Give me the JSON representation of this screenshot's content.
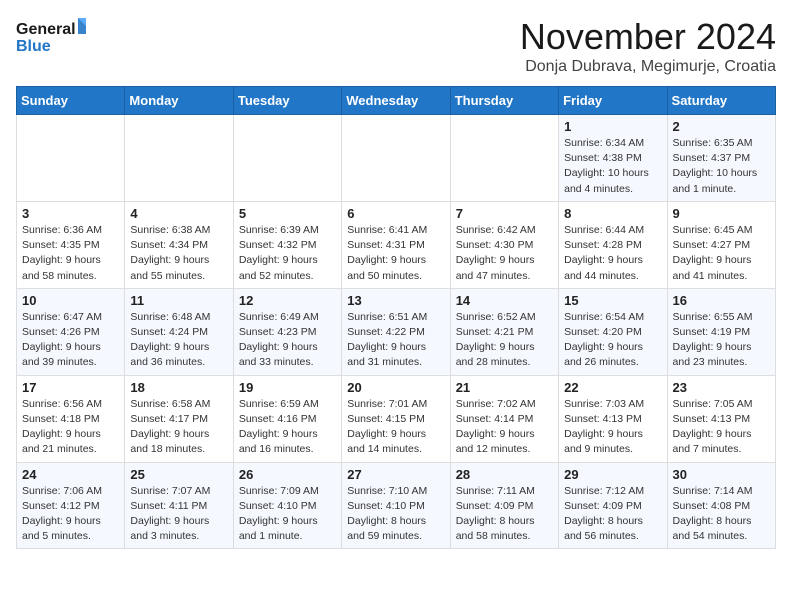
{
  "logo": {
    "line1": "General",
    "line2": "Blue"
  },
  "title": "November 2024",
  "location": "Donja Dubrava, Megimurje, Croatia",
  "days_of_week": [
    "Sunday",
    "Monday",
    "Tuesday",
    "Wednesday",
    "Thursday",
    "Friday",
    "Saturday"
  ],
  "weeks": [
    [
      {
        "num": "",
        "info": ""
      },
      {
        "num": "",
        "info": ""
      },
      {
        "num": "",
        "info": ""
      },
      {
        "num": "",
        "info": ""
      },
      {
        "num": "",
        "info": ""
      },
      {
        "num": "1",
        "info": "Sunrise: 6:34 AM\nSunset: 4:38 PM\nDaylight: 10 hours\nand 4 minutes."
      },
      {
        "num": "2",
        "info": "Sunrise: 6:35 AM\nSunset: 4:37 PM\nDaylight: 10 hours\nand 1 minute."
      }
    ],
    [
      {
        "num": "3",
        "info": "Sunrise: 6:36 AM\nSunset: 4:35 PM\nDaylight: 9 hours\nand 58 minutes."
      },
      {
        "num": "4",
        "info": "Sunrise: 6:38 AM\nSunset: 4:34 PM\nDaylight: 9 hours\nand 55 minutes."
      },
      {
        "num": "5",
        "info": "Sunrise: 6:39 AM\nSunset: 4:32 PM\nDaylight: 9 hours\nand 52 minutes."
      },
      {
        "num": "6",
        "info": "Sunrise: 6:41 AM\nSunset: 4:31 PM\nDaylight: 9 hours\nand 50 minutes."
      },
      {
        "num": "7",
        "info": "Sunrise: 6:42 AM\nSunset: 4:30 PM\nDaylight: 9 hours\nand 47 minutes."
      },
      {
        "num": "8",
        "info": "Sunrise: 6:44 AM\nSunset: 4:28 PM\nDaylight: 9 hours\nand 44 minutes."
      },
      {
        "num": "9",
        "info": "Sunrise: 6:45 AM\nSunset: 4:27 PM\nDaylight: 9 hours\nand 41 minutes."
      }
    ],
    [
      {
        "num": "10",
        "info": "Sunrise: 6:47 AM\nSunset: 4:26 PM\nDaylight: 9 hours\nand 39 minutes."
      },
      {
        "num": "11",
        "info": "Sunrise: 6:48 AM\nSunset: 4:24 PM\nDaylight: 9 hours\nand 36 minutes."
      },
      {
        "num": "12",
        "info": "Sunrise: 6:49 AM\nSunset: 4:23 PM\nDaylight: 9 hours\nand 33 minutes."
      },
      {
        "num": "13",
        "info": "Sunrise: 6:51 AM\nSunset: 4:22 PM\nDaylight: 9 hours\nand 31 minutes."
      },
      {
        "num": "14",
        "info": "Sunrise: 6:52 AM\nSunset: 4:21 PM\nDaylight: 9 hours\nand 28 minutes."
      },
      {
        "num": "15",
        "info": "Sunrise: 6:54 AM\nSunset: 4:20 PM\nDaylight: 9 hours\nand 26 minutes."
      },
      {
        "num": "16",
        "info": "Sunrise: 6:55 AM\nSunset: 4:19 PM\nDaylight: 9 hours\nand 23 minutes."
      }
    ],
    [
      {
        "num": "17",
        "info": "Sunrise: 6:56 AM\nSunset: 4:18 PM\nDaylight: 9 hours\nand 21 minutes."
      },
      {
        "num": "18",
        "info": "Sunrise: 6:58 AM\nSunset: 4:17 PM\nDaylight: 9 hours\nand 18 minutes."
      },
      {
        "num": "19",
        "info": "Sunrise: 6:59 AM\nSunset: 4:16 PM\nDaylight: 9 hours\nand 16 minutes."
      },
      {
        "num": "20",
        "info": "Sunrise: 7:01 AM\nSunset: 4:15 PM\nDaylight: 9 hours\nand 14 minutes."
      },
      {
        "num": "21",
        "info": "Sunrise: 7:02 AM\nSunset: 4:14 PM\nDaylight: 9 hours\nand 12 minutes."
      },
      {
        "num": "22",
        "info": "Sunrise: 7:03 AM\nSunset: 4:13 PM\nDaylight: 9 hours\nand 9 minutes."
      },
      {
        "num": "23",
        "info": "Sunrise: 7:05 AM\nSunset: 4:13 PM\nDaylight: 9 hours\nand 7 minutes."
      }
    ],
    [
      {
        "num": "24",
        "info": "Sunrise: 7:06 AM\nSunset: 4:12 PM\nDaylight: 9 hours\nand 5 minutes."
      },
      {
        "num": "25",
        "info": "Sunrise: 7:07 AM\nSunset: 4:11 PM\nDaylight: 9 hours\nand 3 minutes."
      },
      {
        "num": "26",
        "info": "Sunrise: 7:09 AM\nSunset: 4:10 PM\nDaylight: 9 hours\nand 1 minute."
      },
      {
        "num": "27",
        "info": "Sunrise: 7:10 AM\nSunset: 4:10 PM\nDaylight: 8 hours\nand 59 minutes."
      },
      {
        "num": "28",
        "info": "Sunrise: 7:11 AM\nSunset: 4:09 PM\nDaylight: 8 hours\nand 58 minutes."
      },
      {
        "num": "29",
        "info": "Sunrise: 7:12 AM\nSunset: 4:09 PM\nDaylight: 8 hours\nand 56 minutes."
      },
      {
        "num": "30",
        "info": "Sunrise: 7:14 AM\nSunset: 4:08 PM\nDaylight: 8 hours\nand 54 minutes."
      }
    ]
  ]
}
